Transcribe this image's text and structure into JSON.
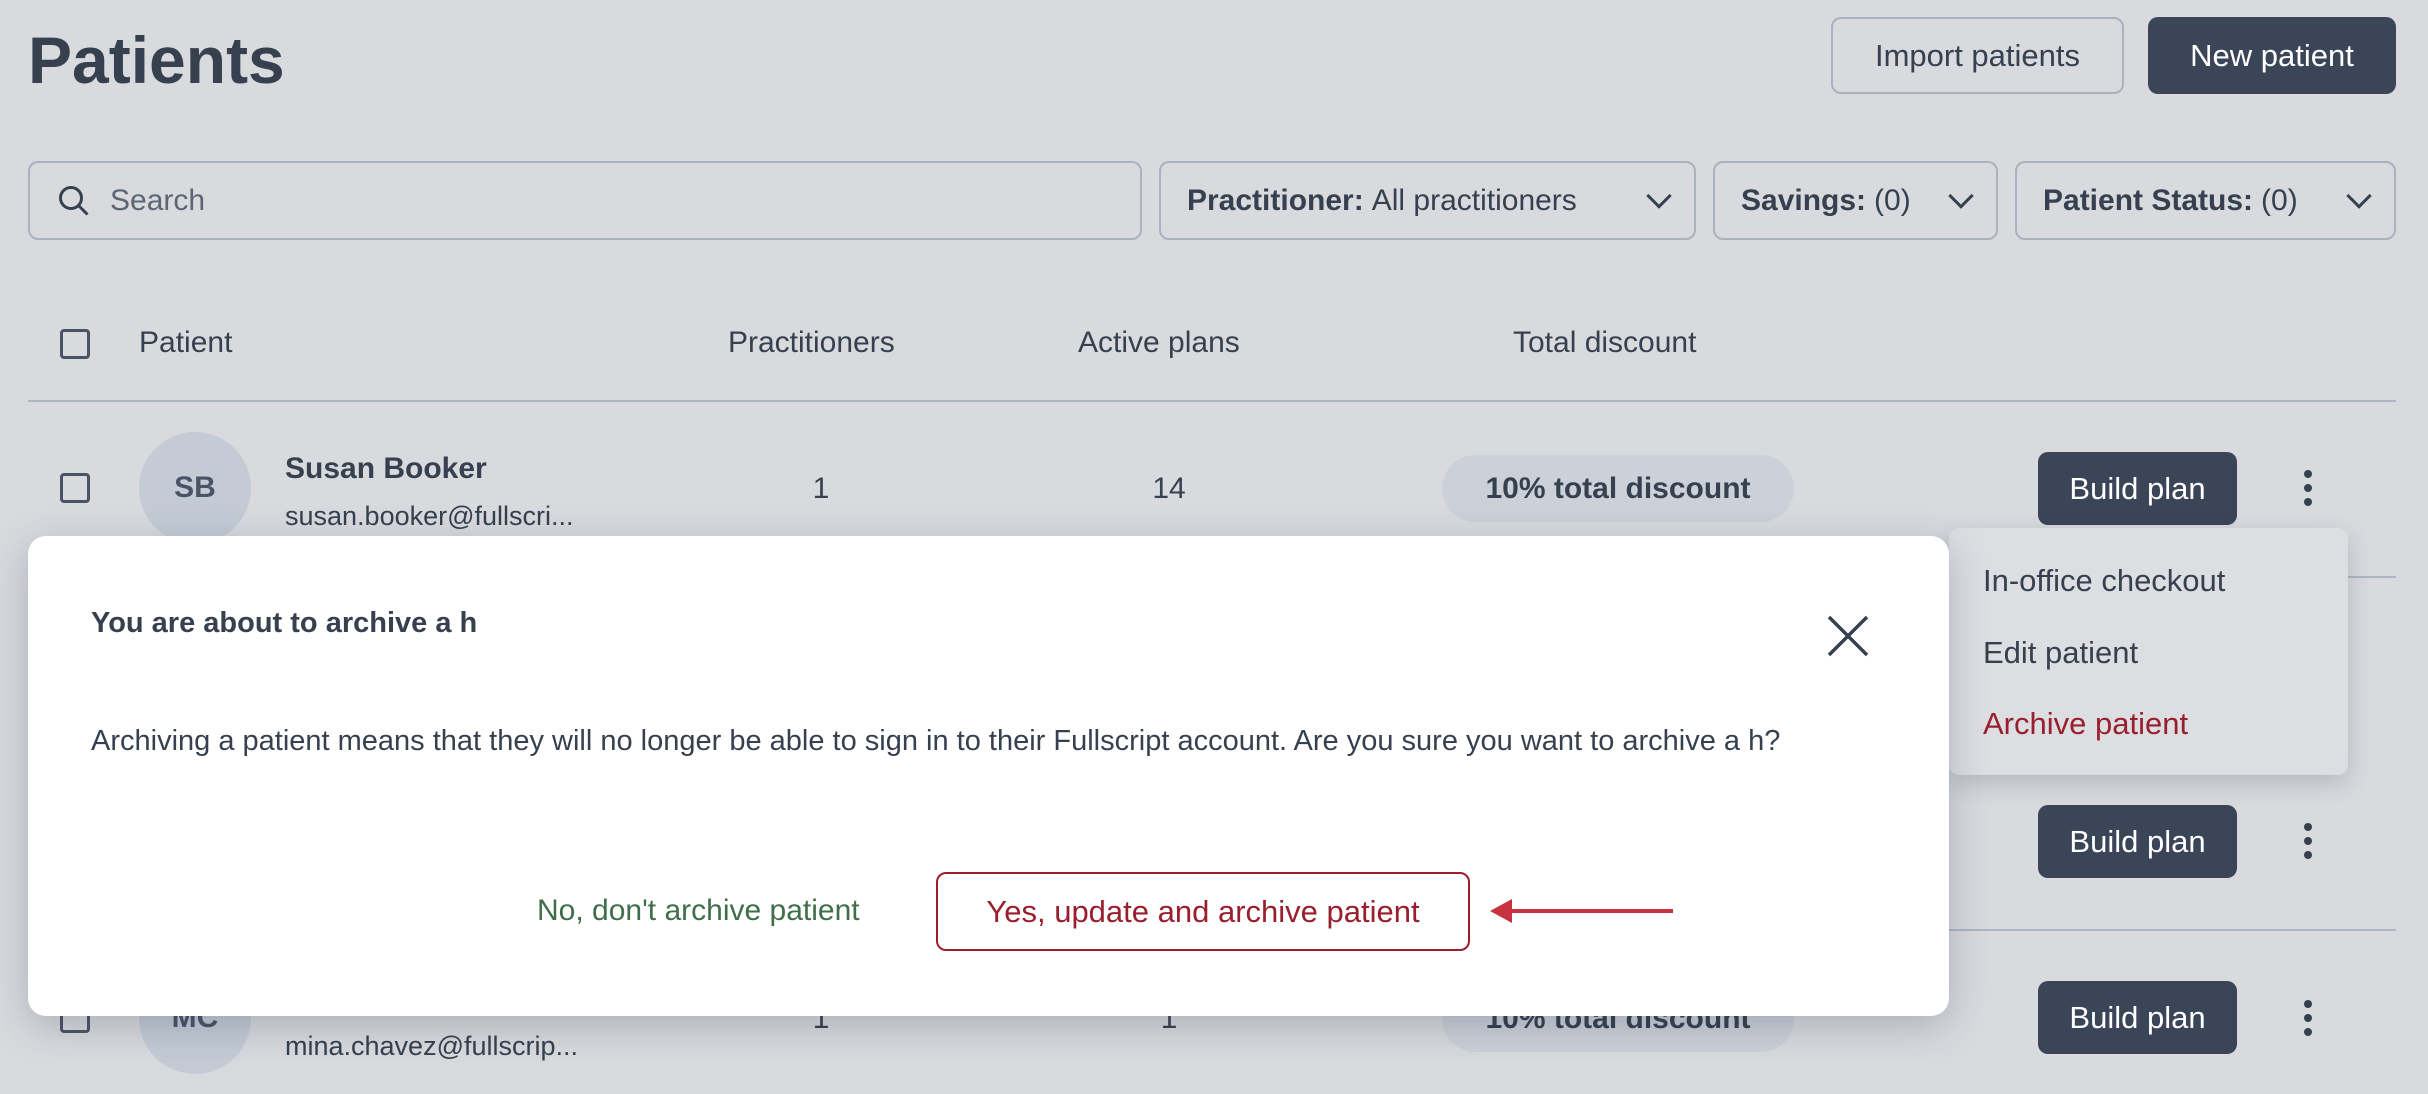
{
  "page": {
    "title": "Patients"
  },
  "header": {
    "import_label": "Import patients",
    "new_label": "New patient"
  },
  "filters": {
    "search_placeholder": "Search",
    "practitioner": {
      "label": "Practitioner:",
      "value": "All practitioners"
    },
    "savings": {
      "label": "Savings:",
      "value": "(0)"
    },
    "status": {
      "label": "Patient Status:",
      "value": "(0)"
    }
  },
  "table": {
    "columns": [
      "Patient",
      "Practitioners",
      "Active plans",
      "Total discount"
    ],
    "rows": [
      {
        "initials": "SB",
        "name": "Susan Booker",
        "email": "susan.booker@fullscri...",
        "practitioners": "1",
        "active_plans": "14",
        "discount": "10% total discount",
        "action": "Build plan"
      },
      {
        "action": "Build plan"
      },
      {
        "initials": "MC",
        "email": "mina.chavez@fullscrip...",
        "practitioners": "1",
        "active_plans": "1",
        "discount": "10% total discount",
        "action": "Build plan"
      }
    ]
  },
  "menu": {
    "items": [
      "In-office checkout",
      "Edit patient",
      "Archive patient"
    ]
  },
  "modal": {
    "title": "You are about to archive a h",
    "body": "Archiving a patient means that they will no longer be able to sign in to their Fullscript account. Are you sure you want to archive a h?",
    "cancel_label": "No, don't archive patient",
    "confirm_label": "Yes, update and archive patient"
  },
  "colors": {
    "primary": "#3a4558",
    "danger": "#9a1f2e",
    "cancel": "#3f6e4a",
    "arrow": "#c8323f"
  }
}
